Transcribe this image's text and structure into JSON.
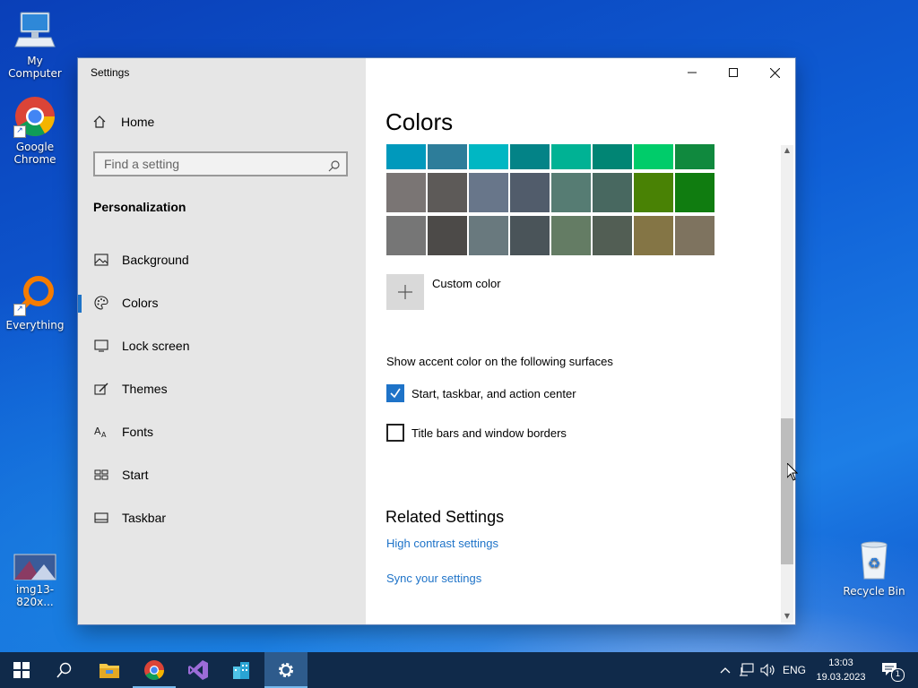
{
  "desktop": {
    "icons": [
      {
        "label": "My Computer"
      },
      {
        "label": "Google Chrome"
      },
      {
        "label": "Everything"
      },
      {
        "label": "img13-820x..."
      },
      {
        "label": "Recycle Bin"
      }
    ]
  },
  "window": {
    "title": "Settings",
    "sidebar": {
      "home_label": "Home",
      "search_placeholder": "Find a setting",
      "section_heading": "Personalization",
      "items": [
        {
          "label": "Background",
          "icon": "picture-icon"
        },
        {
          "label": "Colors",
          "icon": "palette-icon",
          "active": true
        },
        {
          "label": "Lock screen",
          "icon": "lock-screen-icon"
        },
        {
          "label": "Themes",
          "icon": "brush-icon"
        },
        {
          "label": "Fonts",
          "icon": "font-icon"
        },
        {
          "label": "Start",
          "icon": "start-icon"
        },
        {
          "label": "Taskbar",
          "icon": "taskbar-icon"
        }
      ]
    },
    "main": {
      "heading": "Colors",
      "swatches": [
        [
          "#0099bc",
          "#2d7d9a",
          "#00b7c3",
          "#038387",
          "#00b294",
          "#018574",
          "#00cc6a",
          "#10893e"
        ],
        [
          "#7a7574",
          "#5d5a58",
          "#68768a",
          "#515c6b",
          "#567c73",
          "#486860",
          "#498205",
          "#107c10"
        ],
        [
          "#767676",
          "#4c4a48",
          "#69797e",
          "#4a5459",
          "#647c64",
          "#525e54",
          "#847545",
          "#7e735f"
        ]
      ],
      "custom_color_label": "Custom color",
      "surfaces_heading": "Show accent color on the following surfaces",
      "checkboxes": [
        {
          "label": "Start, taskbar, and action center",
          "checked": true
        },
        {
          "label": "Title bars and window borders",
          "checked": false
        }
      ],
      "related_heading": "Related Settings",
      "links": [
        "High contrast settings",
        "Sync your settings"
      ]
    }
  },
  "taskbar": {
    "language": "ENG",
    "time": "13:03",
    "date": "19.03.2023",
    "notification_count": "1"
  },
  "colors": {
    "accent": "#1e73c8",
    "taskbar_bg": "#102a4a"
  }
}
